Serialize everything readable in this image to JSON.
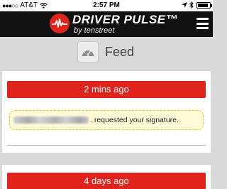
{
  "status_bar": {
    "signal_dots": "●●●○○",
    "carrier": "AT&T",
    "time": "2:57 PM",
    "icons": [
      "signal-icon",
      "wifi-icon",
      "location-icon",
      "bluetooth-icon",
      "battery-icon"
    ],
    "battery_level": 0.9
  },
  "header": {
    "logo_title": "DRIVER PULSE™",
    "logo_subtitle": "by tenstreet",
    "brand_color": "#e0241b"
  },
  "feed": {
    "title": "Feed",
    "icon": "speedometer-icon",
    "items": [
      {
        "time_label": "2 mins ago",
        "message": ". requested your signature."
      },
      {
        "time_label": "4 days ago"
      }
    ]
  }
}
